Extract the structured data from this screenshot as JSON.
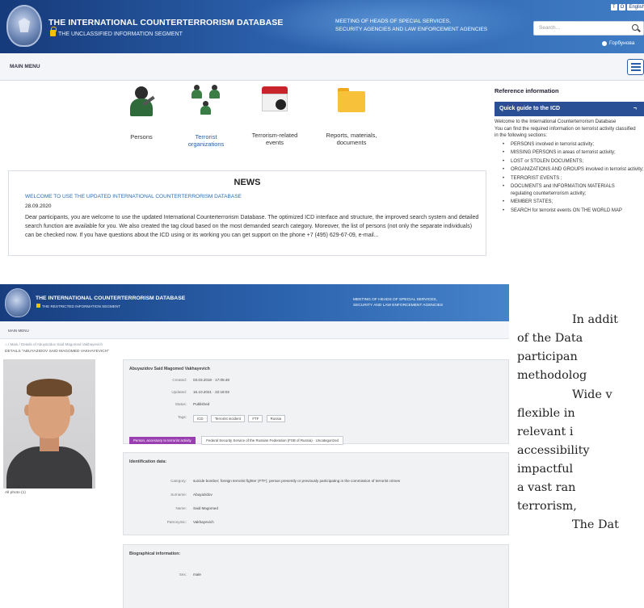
{
  "top": {
    "title": "THE INTERNATIONAL COUNTERTERRORISM DATABASE",
    "subtitle": "THE UNCLASSIFIED INFORMATION SEGMENT",
    "meeting_line1": "MEETING OF HEADS OF SPECIAL SERVICES,",
    "meeting_line2": "SECURITY AGENCIES AND LAW ENFORCEMENT AGENCIES",
    "lang_a": "T",
    "lang_b": "O",
    "lang_selected": "English",
    "search_placeholder": "Search...",
    "user_label": "Горбунова",
    "main_menu": "MAIN MENU",
    "tiles": [
      {
        "label": "Persons"
      },
      {
        "label_line1": "Terrorist",
        "label_line2": "organizations"
      },
      {
        "label_line1": "Terrorism-related",
        "label_line2": "events"
      },
      {
        "label_line1": "Reports, materials,",
        "label_line2": "documents"
      }
    ],
    "news": {
      "title": "NEWS",
      "headline": "WELCOME TO USE THE UPDATED INTERNATIONAL COUNTERTERRORISM DATABASE",
      "date": "28.09.2020",
      "body": "Dear participants, you are welcome to use the updated International Counterterrorism Database. The optimized ICD interface and structure, the improved search system and detailed search function are available for you. We also created the tag cloud based on the most demanded search category. Moreover, the list of persons (not only the separate individuals) can be checked now. If you have questions about the ICD using or its working you can get support on the phone +7 (495) 629-67-09, e-mail..."
    },
    "reference": {
      "heading": "Reference information",
      "guide_title": "Quick guide to the ICD",
      "guide_mark": "¬",
      "intro1": "Welcome to the International Counterterrorism Database",
      "intro2": "You can find the required information on terrorist activity classified",
      "intro3": "in the following sections:",
      "items": [
        "PERSONS involved in terrorist activity;",
        "MISSING PERSONS in areas of terrorist activity;",
        "LOST or STOLEN DOCUMENTS;",
        "ORGANIZATIONS AND GROUPS involved in terrorist activity;",
        "TERRORIST EVENTS ;",
        "DOCUMENTS and INFORMATION MATERIALS regulating counterterrorism activity;",
        "MEMBER STATES;",
        "SEARCH for terrorist events ON THE WORLD MAP"
      ]
    }
  },
  "bottom": {
    "title": "THE INTERNATIONAL COUNTERTERRORISM DATABASE",
    "subtitle": "THE RESTRICTED INFORMATION SEGMENT",
    "meeting_line1": "MEETING OF HEADS OF SPECIAL SERVICES,",
    "meeting_line2": "SECURITY AND LAW ENFORCEMENT AGENCIES",
    "main_menu": "MAIN MENU",
    "breadcrumb": "⌂ / Main / Details of Abuyazidov Said Magomed Vakhayevich",
    "details_title": "DETAILS \"ABUYAZIDOV SAID MAGOMED VAKHAYEVICH\"",
    "photo_label": "All photo (1)",
    "record": {
      "name": "Abuyazidov Said Magomed Vakhayevich",
      "created_label": "Created:",
      "created": "03.03.2018 · 17:05:48",
      "updated_label": "Updated:",
      "updated": "16.10.2021 · 22:18:02",
      "status_label": "Status:",
      "status": "Published",
      "tags_label": "Tags:",
      "tags": [
        "ICD",
        "Terrorist incident",
        "FTF",
        "Russia"
      ],
      "org_badge": "Person, accessory to terrorist activity",
      "org_source": "Federal Security Service of the Russian Federation (FSB of Russia) · Uncategorized"
    },
    "identification": {
      "title": "Identification data:",
      "category_label": "Category:",
      "category": "suicide bomber; foreign terrorist fighter (FTF); person presently or previously participating in the commission of terrorist crimes",
      "surname_label": "Surname:",
      "surname": "Abuyazidov",
      "name_label": "Name:",
      "name": "Said Magomed",
      "patronymic_label": "Patronymic:",
      "patronymic": "Vakhayevich"
    },
    "biographical": {
      "title": "Biographical information:",
      "sex_label": "Sex:",
      "sex": "male"
    }
  },
  "article": {
    "lines": [
      "In addit",
      "of the Data",
      "participan",
      "methodolog",
      "Wide v",
      "flexible in",
      "relevant i",
      "accessibility",
      "impactful",
      "a vast ran",
      "terrorism,",
      "The Dat"
    ]
  },
  "colors": {
    "header_blue": "#2a5ea8",
    "guide_bar": "#2a4f94",
    "link_blue": "#2a6db6",
    "org_badge_purple": "#9a3fb0",
    "lock_yellow": "#f2c300"
  }
}
